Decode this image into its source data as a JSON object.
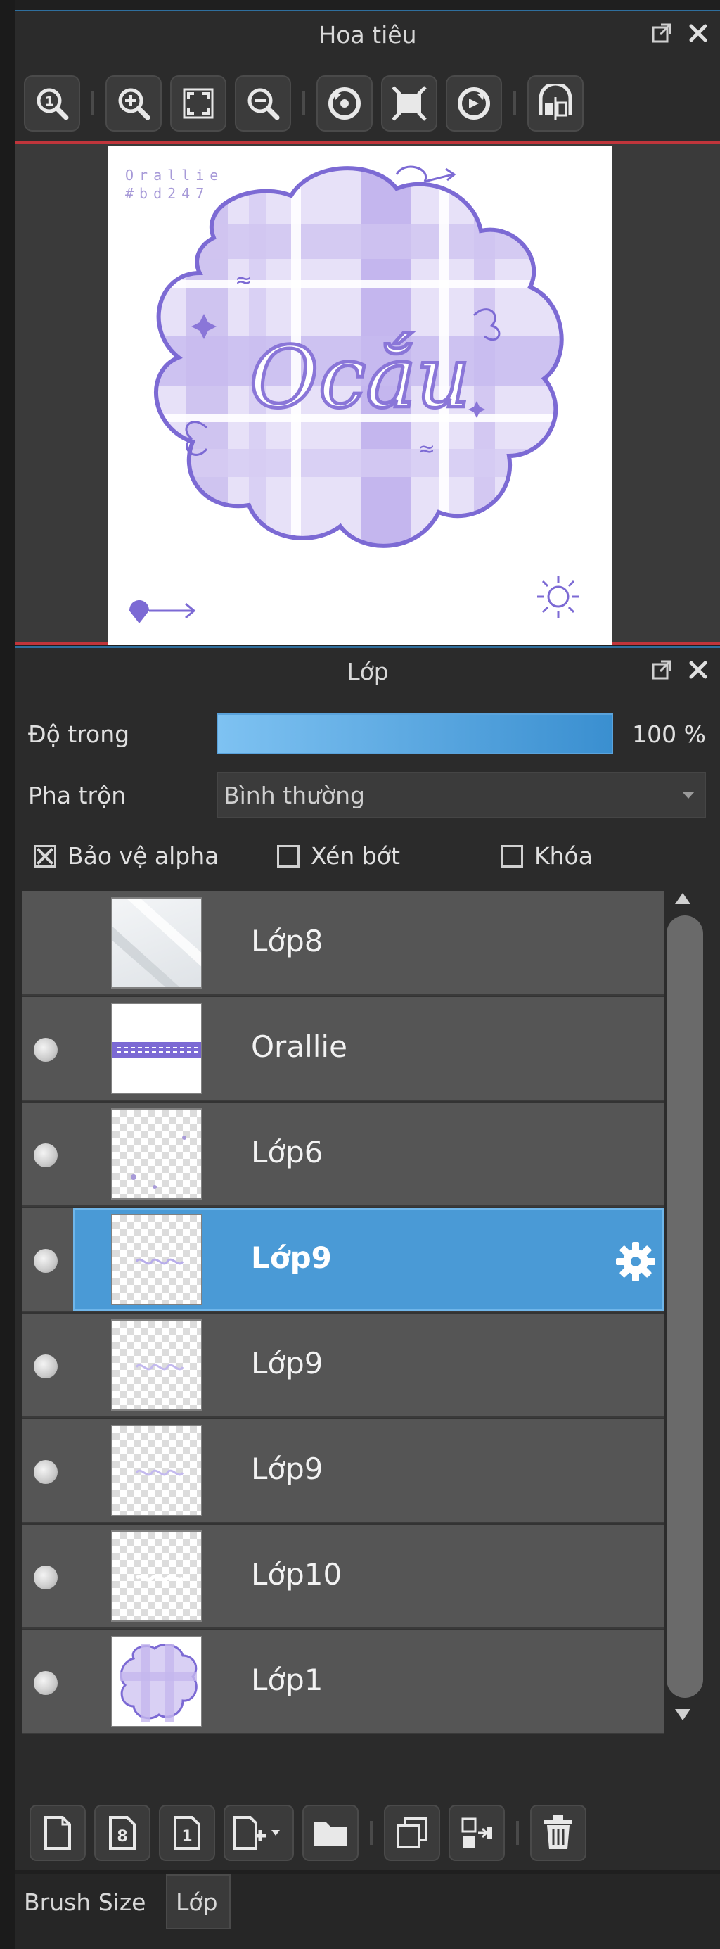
{
  "navigator": {
    "title": "Hoa tiêu",
    "tools": [
      "zoom-actual-icon",
      "zoom-in-icon",
      "fit-icon",
      "zoom-out-icon",
      "rotate-left-icon",
      "fill-screen-icon",
      "rotate-right-icon",
      "flip-icon"
    ],
    "artwork": {
      "signature_line1": "Orallie",
      "signature_line2": "#bd247",
      "word": "Ocắu"
    }
  },
  "layers_panel": {
    "title": "Lớp",
    "opacity_label": "Độ trong",
    "opacity_value": "100 %",
    "opacity_fraction": 1.0,
    "blend_label": "Pha trộn",
    "blend_value": "Bình thường",
    "protect_alpha_label": "Bảo vệ alpha",
    "protect_alpha_checked": true,
    "clipping_label": "Xén bớt",
    "clipping_checked": false,
    "lock_label": "Khóa",
    "lock_checked": false,
    "layers": [
      {
        "name": "Lớp8",
        "visible": false,
        "selected": false,
        "thumb": "plain"
      },
      {
        "name": "Orallie",
        "visible": true,
        "selected": false,
        "thumb": "text"
      },
      {
        "name": "Lớp6",
        "visible": true,
        "selected": false,
        "thumb": "checker"
      },
      {
        "name": "Lớp9",
        "visible": true,
        "selected": true,
        "thumb": "checker"
      },
      {
        "name": "Lớp9",
        "visible": true,
        "selected": false,
        "thumb": "checker"
      },
      {
        "name": "Lớp9",
        "visible": true,
        "selected": false,
        "thumb": "checker"
      },
      {
        "name": "Lớp10",
        "visible": true,
        "selected": false,
        "thumb": "checker"
      },
      {
        "name": "Lớp1",
        "visible": true,
        "selected": false,
        "thumb": "cloud"
      }
    ]
  },
  "tabs": [
    {
      "label": "Brush Size",
      "active": false
    },
    {
      "label": "Lớp",
      "active": true
    }
  ],
  "colors": {
    "panel_bg": "#2b2b2b",
    "selected_row": "#4a9ad6",
    "accent_blue": "#2f6f9e",
    "view_border_red": "#c0353b",
    "art_purple": "#7c6ad4"
  }
}
